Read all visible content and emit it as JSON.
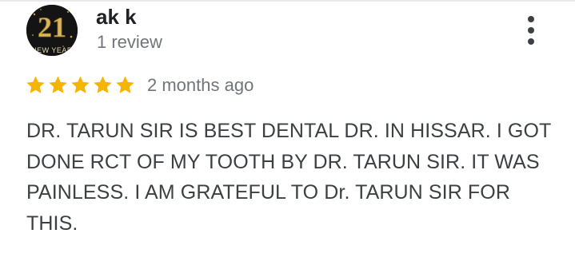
{
  "reviewer": {
    "name": "ak k",
    "review_count": "1 review",
    "avatar": {
      "icon": "new-year-21-avatar",
      "number_text": "21",
      "caption_text": "NEW YEAR"
    }
  },
  "rating": {
    "stars": 5,
    "max_stars": 5,
    "star_color": "#f4b400"
  },
  "review": {
    "date": "2 months ago",
    "text": "DR. TARUN SIR IS BEST DENTAL DR. IN HISSAR. I GOT DONE RCT OF MY TOOTH BY DR. TARUN SIR. IT WAS PAINLESS. I AM GRATEFUL TO Dr. TARUN SIR FOR THIS."
  },
  "actions": {
    "more_icon": "more-vert-icon"
  }
}
